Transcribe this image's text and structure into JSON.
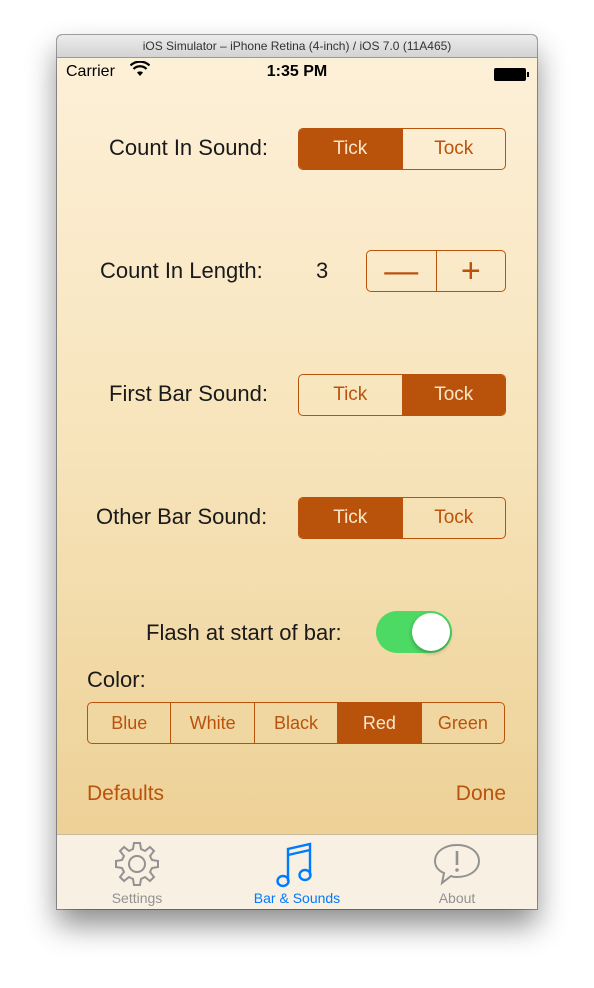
{
  "window": {
    "title": "iOS Simulator – iPhone Retina (4-inch) / iOS 7.0 (11A465)"
  },
  "status_bar": {
    "carrier": "Carrier",
    "time": "1:35 PM"
  },
  "count_in_sound": {
    "label": "Count In Sound:",
    "options": [
      "Tick",
      "Tock"
    ],
    "selected": "Tick"
  },
  "count_in_length": {
    "label": "Count In Length:",
    "value": "3",
    "decrement": "—",
    "increment": "+"
  },
  "first_bar_sound": {
    "label": "First Bar Sound:",
    "options": [
      "Tick",
      "Tock"
    ],
    "selected": "Tock"
  },
  "other_bar_sound": {
    "label": "Other Bar Sound:",
    "options": [
      "Tick",
      "Tock"
    ],
    "selected": "Tick"
  },
  "flash": {
    "label": "Flash at start of bar:",
    "on": true
  },
  "color": {
    "label": "Color:",
    "options": [
      "Blue",
      "White",
      "Black",
      "Red",
      "Green"
    ],
    "selected": "Red"
  },
  "actions": {
    "defaults": "Defaults",
    "done": "Done"
  },
  "tab_bar": {
    "tabs": [
      {
        "label": "Settings",
        "icon": "gear-icon",
        "active": false
      },
      {
        "label": "Bar & Sounds",
        "icon": "music-note-icon",
        "active": true
      },
      {
        "label": "About",
        "icon": "speech-bubble-exclamation-icon",
        "active": false
      }
    ]
  },
  "colors": {
    "accent": "#b9530c",
    "toggle_on": "#4cd964",
    "tab_active": "#007aff",
    "tab_inactive": "#929292"
  }
}
